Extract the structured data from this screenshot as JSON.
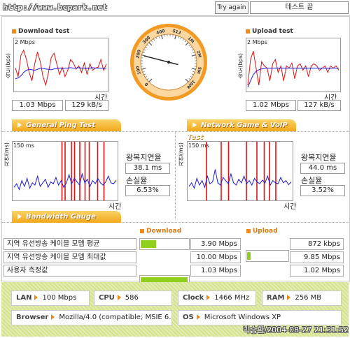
{
  "top": {
    "url": "http://www.bcpark.net",
    "try_again": "Try again",
    "status": "테스트 끝"
  },
  "download": {
    "title": "Download test",
    "scale": "2 Mbps",
    "y_axis": "속도(bps)",
    "x_axis": "시간",
    "mbps": "1.03 Mbps",
    "kbs": "129 kB/s",
    "series": {
      "red": [
        0.5,
        0.3,
        0.8,
        0.92,
        0.7,
        0.4,
        0.2,
        0.6,
        0.88,
        0.65,
        0.3,
        0.1,
        0.4,
        0.75,
        0.85,
        0.6,
        0.35,
        0.52,
        0.3,
        0.45,
        0.7,
        0.62,
        0.48,
        0.55,
        0.4,
        0.62,
        0.35,
        0.6,
        0.45,
        0.5,
        0.52,
        0.7,
        0.45,
        0.6
      ],
      "blue": [
        0.25,
        0.27,
        0.32,
        0.4,
        0.45,
        0.47,
        0.46,
        0.45,
        0.47,
        0.5,
        0.49,
        0.48,
        0.47,
        0.46,
        0.48,
        0.49,
        0.5,
        0.49,
        0.5,
        0.5,
        0.51,
        0.5,
        0.5,
        0.51,
        0.5,
        0.5,
        0.5,
        0.5,
        0.51,
        0.5,
        0.5,
        0.5,
        0.5,
        0.5
      ]
    }
  },
  "upload": {
    "title": "Upload test",
    "scale": "2 Mbps",
    "y_axis": "속도(bps)",
    "x_axis": "시간",
    "mbps": "1.02 Mbps",
    "kbs": "127 kB/s",
    "series": {
      "red": [
        0.1,
        0.7,
        0.9,
        0.5,
        0.1,
        0.65,
        0.55,
        0.5,
        0.2,
        0.6,
        0.7,
        0.4,
        0.55,
        0.2,
        0.55,
        0.5,
        0.62,
        0.25,
        0.55,
        0.6,
        0.45,
        0.55,
        0.3,
        0.55,
        0.6,
        0.55,
        0.45,
        0.5,
        0.55,
        0.4,
        0.55,
        0.5,
        0.55,
        0.45
      ],
      "blue": [
        0.05,
        0.2,
        0.35,
        0.42,
        0.46,
        0.48,
        0.49,
        0.5,
        0.5,
        0.5,
        0.5,
        0.5,
        0.5,
        0.5,
        0.5,
        0.5,
        0.5,
        0.5,
        0.5,
        0.5,
        0.5,
        0.5,
        0.5,
        0.5,
        0.5,
        0.5,
        0.5,
        0.5,
        0.5,
        0.5,
        0.5,
        0.5,
        0.5,
        0.5
      ]
    }
  },
  "gauge": {
    "labels": [
      "0",
      "100",
      "200",
      "300",
      "400",
      "512",
      "1M",
      "2M",
      "5M",
      "10M"
    ],
    "needle_fraction": 0.22
  },
  "ping": {
    "tab": "General Ping Test",
    "scale": "150 ms",
    "y_axis": "지연(ms)",
    "x_axis": "시간",
    "rtt_label": "왕복지연율",
    "rtt_value": "38.1 ms",
    "loss_label": "손실율",
    "loss_value": "6.53%",
    "red_spikes": [
      0.47,
      0.5,
      0.56,
      0.59,
      0.64,
      0.69,
      0.73,
      0.81,
      0.87
    ],
    "blue": [
      0.2,
      0.28,
      0.15,
      0.35,
      0.22,
      0.4,
      0.18,
      0.3,
      0.25,
      0.45,
      0.22,
      0.3,
      0.38,
      0.2,
      0.32,
      0.28,
      0.42,
      0.25,
      0.35,
      0.2,
      0.3,
      0.48,
      0.28,
      0.4,
      0.33,
      0.25,
      0.5,
      0.3,
      0.38,
      0.22,
      0.35,
      0.28,
      0.4,
      0.3,
      0.25,
      0.32,
      0.45,
      0.3,
      0.28,
      0.36
    ]
  },
  "game": {
    "tab": "Network Game & VoIP Test",
    "scale": "150 ms",
    "y_axis": "지연(ms)",
    "x_axis": "시간",
    "rtt_label": "왕복지연율",
    "rtt_value": "44.0 ms",
    "loss_label": "손실율",
    "loss_value": "3.52%",
    "red_spikes": [
      0.18,
      0.32,
      0.39,
      0.56,
      0.66,
      0.73,
      0.78,
      0.84
    ],
    "blue": [
      0.22,
      0.3,
      0.18,
      0.4,
      0.25,
      0.35,
      0.2,
      0.45,
      0.28,
      0.32,
      0.6,
      0.3,
      0.25,
      0.42,
      0.35,
      0.28,
      0.5,
      0.3,
      0.25,
      0.38,
      0.3,
      0.45,
      0.28,
      0.35,
      0.25,
      0.4,
      0.32,
      0.28,
      0.36,
      0.3,
      0.45,
      0.25,
      0.35,
      0.3,
      0.28,
      0.42,
      0.3,
      0.35,
      0.26,
      0.32
    ]
  },
  "bandwidth": {
    "tab": "Bandwidth Gauge",
    "download_header": "Download",
    "upload_header": "Upload",
    "rows": [
      {
        "label": "지역 유선방송 케이블 모뎀 평균",
        "download": "3.90 Mbps",
        "upload": "872 kbps",
        "download_fraction": 0.33,
        "upload_fraction": 0.09
      },
      {
        "label": "지역 유선방송 케이블 모뎀 최대값",
        "download": "10.00 Mbps",
        "upload": "9.85 Mbps",
        "download_fraction": 1.0,
        "upload_fraction": 0.98
      },
      {
        "label": "사용자 측정값",
        "download": "1.03 Mbps",
        "upload": "1.02 Mbps",
        "download_fraction": 0.06,
        "upload_fraction": 0.1
      }
    ]
  },
  "system": {
    "lan_label": "LAN",
    "lan": "100 Mbps",
    "cpu_label": "CPU",
    "cpu": "586",
    "clock_label": "Clock",
    "clock": "1466 MHz",
    "ram_label": "RAM",
    "ram": "256 MB",
    "browser_label": "Browser",
    "browser": "Mozilla/4.0 (compatible; MSIE 6.0",
    "os_label": "OS",
    "os": "Microsoft Windows XP",
    "stamp": "박승환/2004-08-27 21:31:52"
  },
  "colors": {
    "accent": "#f08a1c",
    "bar": "#8fcf1e",
    "series_red": "#e01010",
    "series_blue": "#1a1ae0"
  }
}
